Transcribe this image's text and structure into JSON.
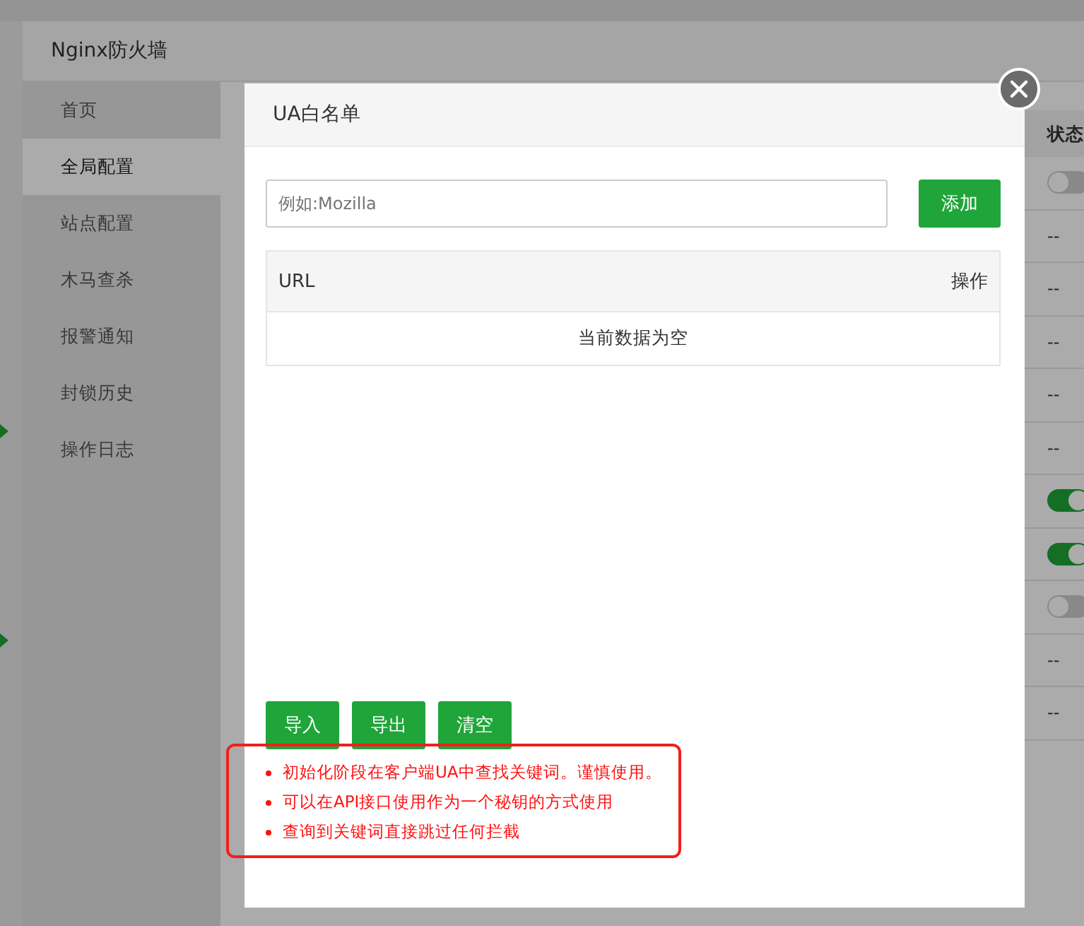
{
  "window": {
    "title": "Nginx防火墙"
  },
  "sidebar": {
    "items": [
      {
        "label": "首页",
        "selected": false
      },
      {
        "label": "全局配置",
        "selected": true
      },
      {
        "label": "站点配置",
        "selected": false
      },
      {
        "label": "木马查杀",
        "selected": false
      },
      {
        "label": "报警通知",
        "selected": false
      },
      {
        "label": "封锁历史",
        "selected": false
      },
      {
        "label": "操作日志",
        "selected": false
      }
    ]
  },
  "table": {
    "column": "状态",
    "rows": [
      {
        "kind": "toggle",
        "on": false
      },
      {
        "kind": "text",
        "text": "--"
      },
      {
        "kind": "text",
        "text": "--"
      },
      {
        "kind": "text",
        "text": "--"
      },
      {
        "kind": "text",
        "text": "--"
      },
      {
        "kind": "text",
        "text": "--"
      },
      {
        "kind": "toggle",
        "on": true
      },
      {
        "kind": "toggle",
        "on": true
      },
      {
        "kind": "toggle",
        "on": false
      },
      {
        "kind": "text",
        "text": "--"
      },
      {
        "kind": "text",
        "text": "--"
      }
    ]
  },
  "dialog": {
    "title": "UA白名单",
    "input": {
      "placeholder": "例如:Mozilla"
    },
    "add_button": "添加",
    "list": {
      "columns": [
        "URL",
        "操作"
      ],
      "empty": "当前数据为空"
    },
    "buttons": [
      "导入",
      "导出",
      "清空"
    ],
    "notes": [
      "初始化阶段在客户端UA中查找关键词。谨慎使用。",
      "可以在API接口使用作为一个秘钥的方式使用",
      "查询到关键词直接跳过任何拦截"
    ]
  }
}
